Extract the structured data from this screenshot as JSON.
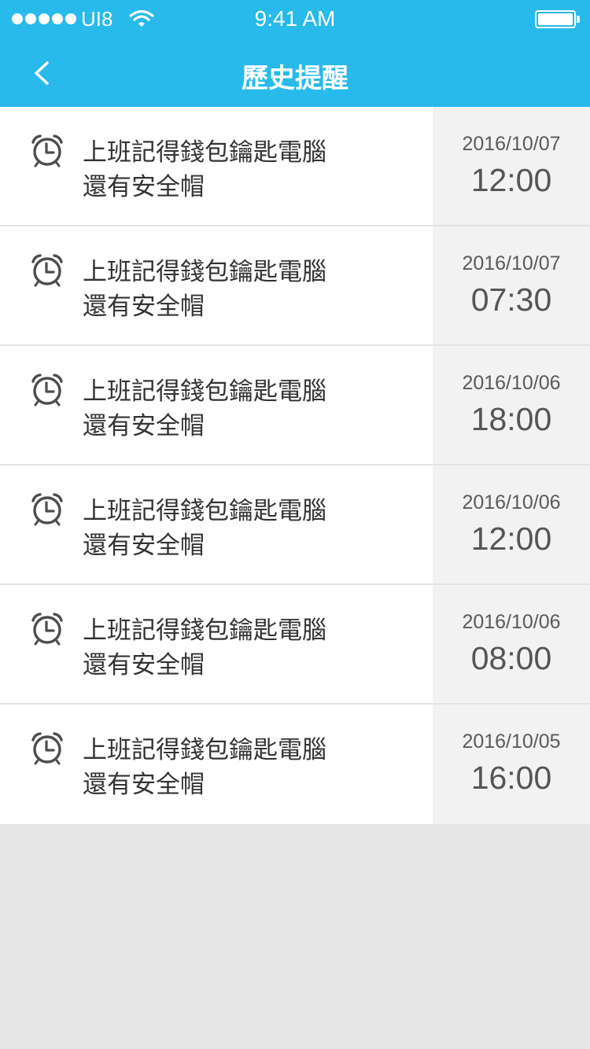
{
  "status_bar": {
    "carrier": "UI8",
    "time": "9:41 AM"
  },
  "nav": {
    "title": "歷史提醒",
    "back_icon": "chevron-left-icon"
  },
  "colors": {
    "accent": "#27baea",
    "row_bg": "#ffffff",
    "time_cell_bg": "#f2f2f2",
    "page_bg": "#e6e6e6"
  },
  "reminders": [
    {
      "text": "上班記得錢包鑰匙電腦還有安全帽",
      "date": "2016/10/07",
      "time": "12:00"
    },
    {
      "text": "上班記得錢包鑰匙電腦還有安全帽",
      "date": "2016/10/07",
      "time": "07:30"
    },
    {
      "text": "上班記得錢包鑰匙電腦還有安全帽",
      "date": "2016/10/06",
      "time": "18:00"
    },
    {
      "text": "上班記得錢包鑰匙電腦還有安全帽",
      "date": "2016/10/06",
      "time": "12:00"
    },
    {
      "text": "上班記得錢包鑰匙電腦還有安全帽",
      "date": "2016/10/06",
      "time": "08:00"
    },
    {
      "text": "上班記得錢包鑰匙電腦還有安全帽",
      "date": "2016/10/05",
      "time": "16:00"
    }
  ]
}
